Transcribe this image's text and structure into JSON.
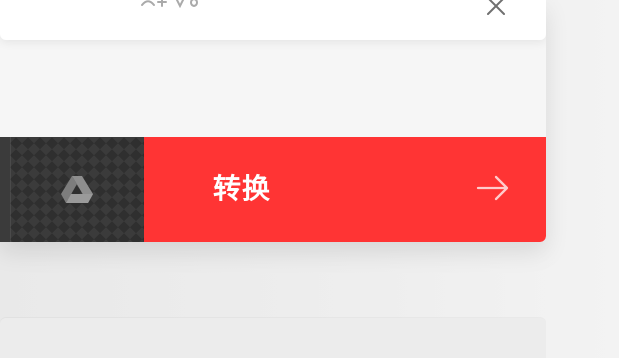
{
  "top_panel": {
    "close_icon": "close-icon"
  },
  "action_bar": {
    "drive_icon": "google-drive-icon",
    "convert_label": "转换",
    "arrow_icon": "arrow-right-icon"
  },
  "colors": {
    "background": "#eeeeee",
    "card": "#f6f6f6",
    "top_panel": "#ffffff",
    "dark_button": "#2f2f2f",
    "primary_red": "#ff3434",
    "icon_gray": "#8e8e8e",
    "white": "#ffffff"
  }
}
